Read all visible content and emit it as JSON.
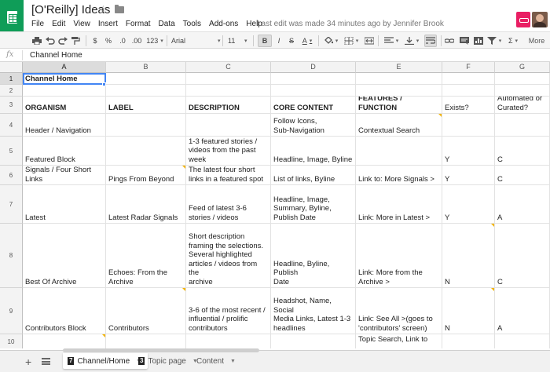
{
  "header": {
    "title": "[O'Reilly] Ideas",
    "menu": [
      "File",
      "Edit",
      "View",
      "Insert",
      "Format",
      "Data",
      "Tools",
      "Add-ons",
      "Help"
    ],
    "last_edit": "Last edit was made 34 minutes ago by Jennifer Brook"
  },
  "toolbar": {
    "currency": "$",
    "percent": "%",
    "dec_decrease": ".0",
    "dec_increase": ".00",
    "number_format": "123",
    "font": "Arial",
    "font_size": "11",
    "bold": "B",
    "italic": "I",
    "strike": "S",
    "text_color": "A",
    "more": "More",
    "sum": "Σ"
  },
  "formula_bar": {
    "fx": "fx",
    "value": "Channel Home"
  },
  "columns": [
    "A",
    "B",
    "C",
    "D",
    "E",
    "F",
    "G"
  ],
  "rows": [
    {
      "num": "1",
      "cells": [
        "Channel Home",
        "",
        "",
        "",
        "",
        "",
        ""
      ]
    },
    {
      "num": "2",
      "cells": [
        "",
        "",
        "",
        "",
        "",
        "",
        ""
      ]
    },
    {
      "num": "3",
      "cells": [
        "ORGANISM",
        "LABEL",
        "DESCRIPTION",
        "CORE CONTENT",
        "FEATURES / FUNCTION",
        "Exists?",
        "Automated or\nCurated?"
      ]
    },
    {
      "num": "4",
      "cells": [
        "Header / Navigation",
        "",
        "",
        "Follow Icons,\nSub-Navigation",
        "Contextual Search",
        "",
        ""
      ]
    },
    {
      "num": "5",
      "cells": [
        "Featured Block",
        "",
        "1-3 featured stories /\nvideos from the past\nweek",
        "Headline, Image, Byline",
        "",
        "Y",
        "C"
      ]
    },
    {
      "num": "6",
      "cells": [
        "Signals / Four Short\nLinks",
        "Pings From Beyond",
        "The latest four short\nlinks in a featured spot",
        "List of links, Byline",
        "Link to: More Signals >",
        "Y",
        "C"
      ]
    },
    {
      "num": "7",
      "cells": [
        "Latest",
        "Latest Radar Signals",
        "Feed of latest 3-6\nstories / videos",
        "Headline, Image,\nSummary, Byline,\nPublish Date",
        "Link: More in Latest >",
        "Y",
        "A"
      ]
    },
    {
      "num": "8",
      "cells": [
        "Best Of Archive",
        "Echoes: From the\nArchive",
        "Short description\nframing the selections.\nSeveral highlighted\narticles / videos from the\narchive",
        "Headline, Byline, Publish\nDate",
        "Link: More from the\nArchive >",
        "N",
        "C"
      ]
    },
    {
      "num": "9",
      "cells": [
        "Contributors Block",
        "Contributors",
        "3-6 of the most recent /\ninfluential / prolific\ncontributors",
        "Headshot, Name, Social\nMedia Links, Latest 1-3\nheadlines",
        "Link: See All >(goes to\n'contributors' screen)",
        "N",
        "A"
      ]
    },
    {
      "num": "10",
      "cells": [
        "",
        "",
        "",
        "",
        "Topic Search, Link to",
        "",
        ""
      ]
    }
  ],
  "sheets": [
    {
      "num": "7",
      "name": "Channel/Home",
      "active": true
    },
    {
      "num": "3",
      "name": "Topic page",
      "active": false
    },
    {
      "num": "",
      "name": "Content",
      "active": false
    }
  ],
  "colors": {
    "brand": "#0f9d58",
    "selection": "#4285f4",
    "note": "#f4b400"
  }
}
